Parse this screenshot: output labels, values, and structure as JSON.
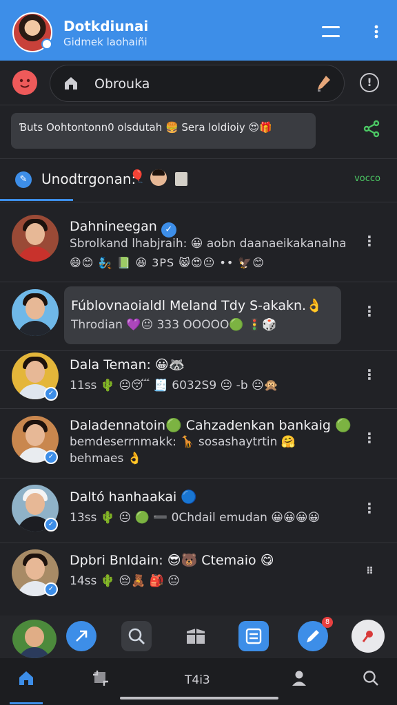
{
  "header": {
    "title": "Dotkdiunai",
    "subtitle": "Gidmek laohaiñi",
    "menu_icon": "hamburger-icon",
    "more_icon": "more-vertical-icon"
  },
  "search": {
    "value": "Obrouka",
    "left_icon": "emoji-face-icon",
    "home_icon": "home-icon",
    "mic_icon": "mic-icon",
    "info_icon": "info-icon"
  },
  "banner": {
    "text": "Ɓuts Oohtontonn0 olsdutah 🍔 Sera loldioiy 😍🎁",
    "leading_emoji": "😜😀",
    "share_icon": "share-icon"
  },
  "tab": {
    "label": "Unodtrgonan:",
    "right_text": "vocco",
    "accent": "#3d8ee8"
  },
  "chats": [
    {
      "name": "Dahnineegan",
      "line1": "Sbrolkand lhabjraih: 😀 aobn daanaeikakanalnahl",
      "emojis": "😄😊 🧞 📗 😆 3PS 😸😍😐 •• 🦅😊",
      "verified": true
    },
    {
      "name": "Fúblovnaoialdl Meland Tdy S-akakn.👌",
      "line1": "Throdian 💜😐 333 OOOOO🟢 🚦🎲",
      "highlighted": true
    },
    {
      "name": "Dala Teman: 😀🦝",
      "line1": "11ss 🌵 😐😴 🧾 6032S9 😐 -b 😐🙊"
    },
    {
      "name": "Daladennatoin🟢 Cahzadenkan bankaig 🟢",
      "line1": "bemdeserrnmakk: 🦒 sosashaytrtin 🤗",
      "line2": "behmaes 👌"
    },
    {
      "name": "Daltó hanhaakai 🔵",
      "line1": "13ss 🌵 😐 🟢 ➖ 0Chdail emudan 😀😀😀😀"
    },
    {
      "name": "Dpbri Bnldain: 😎🐻 Ctemaio 😋",
      "line1": "14ss 🌵 😔🧸 🎒 😐"
    }
  ],
  "dock": {
    "buttons": [
      "share-arrow-icon",
      "search-icon",
      "gift-box-icon",
      "contact-card-icon",
      "pen-edit-icon",
      "pin-marker-icon"
    ],
    "badge_count": "8"
  },
  "nav": {
    "label": "T4i3",
    "items": [
      "home-icon",
      "crop-icon",
      "profile-icon",
      "search-icon"
    ]
  },
  "colors": {
    "brand": "#3d8ee8",
    "background": "#212226",
    "online": "#4cc864"
  }
}
